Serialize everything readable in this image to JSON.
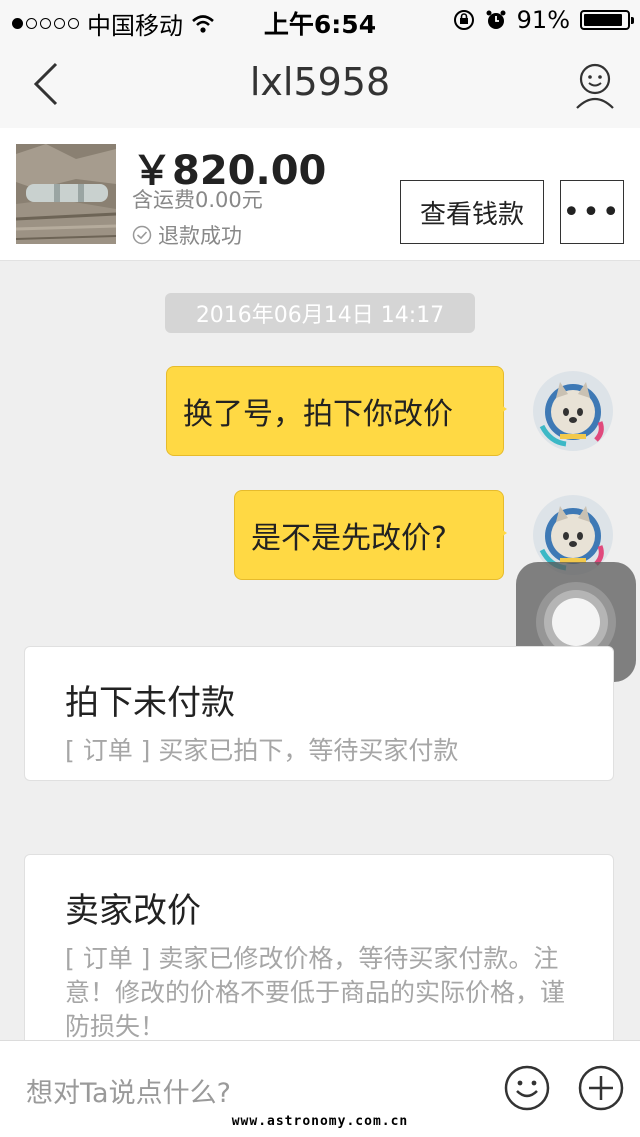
{
  "status_bar": {
    "carrier": "中国移动",
    "time": "上午6:54",
    "battery": "91%",
    "battery_level": 0.91
  },
  "nav": {
    "title": "lxl5958"
  },
  "product": {
    "price": "￥820.00",
    "shipping": "含运费0.00元",
    "status": "退款成功",
    "view_payment_label": "查看钱款",
    "more_label": "•••"
  },
  "chat": {
    "timestamp": "2016年06月14日 14:17",
    "messages": [
      {
        "text": "换了号，拍下你改价"
      },
      {
        "text": "是不是先改价?"
      }
    ]
  },
  "cards": [
    {
      "title": "拍下未付款",
      "body": "[ 订单 ] 买家已拍下，等待买家付款"
    },
    {
      "title": "卖家改价",
      "body": "[ 订单 ] 卖家已修改价格，等待买家付款。注意！修改的价格不要低于商品的实际价格，谨防损失！"
    }
  ],
  "input": {
    "placeholder": "想对Ta说点什么?"
  },
  "watermark": "www.astronomy.com.cn",
  "colors": {
    "bubble": "#ffd944",
    "background": "#efefef"
  }
}
